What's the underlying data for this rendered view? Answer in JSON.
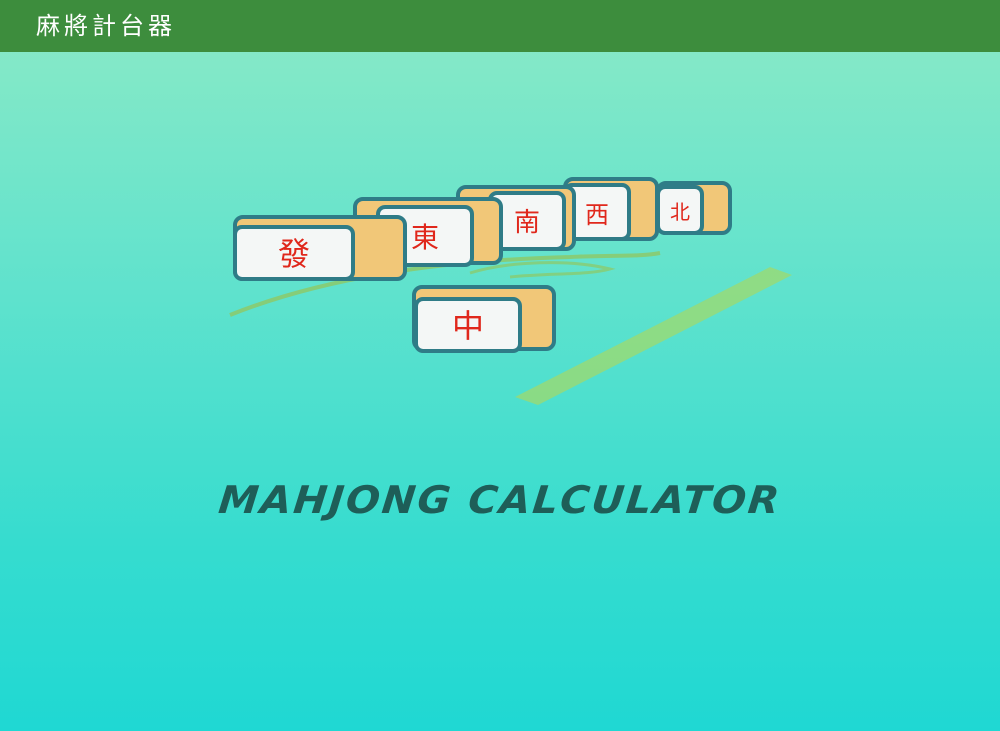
{
  "app": {
    "title": "麻將計台器",
    "toolbar_color": "#3d8d3d",
    "name_label": "MAHJONG CALCULATOR"
  },
  "illustration": {
    "tiles": [
      {
        "name": "tile-fa",
        "glyph": "發"
      },
      {
        "name": "tile-dong",
        "glyph": "東"
      },
      {
        "name": "tile-nan",
        "glyph": "南"
      },
      {
        "name": "tile-xi",
        "glyph": "西"
      },
      {
        "name": "tile-bei",
        "glyph": "北"
      },
      {
        "name": "tile-zhong",
        "glyph": "中"
      }
    ]
  },
  "colors": {
    "background_top": "#8ceac6",
    "background_bottom": "#1fd8d3",
    "tile_face": "#f4f7f6",
    "tile_side": "#f1c778",
    "tile_outline": "#2f7c87",
    "glyph": "#e0281c",
    "title_text": "#1e5e58"
  }
}
